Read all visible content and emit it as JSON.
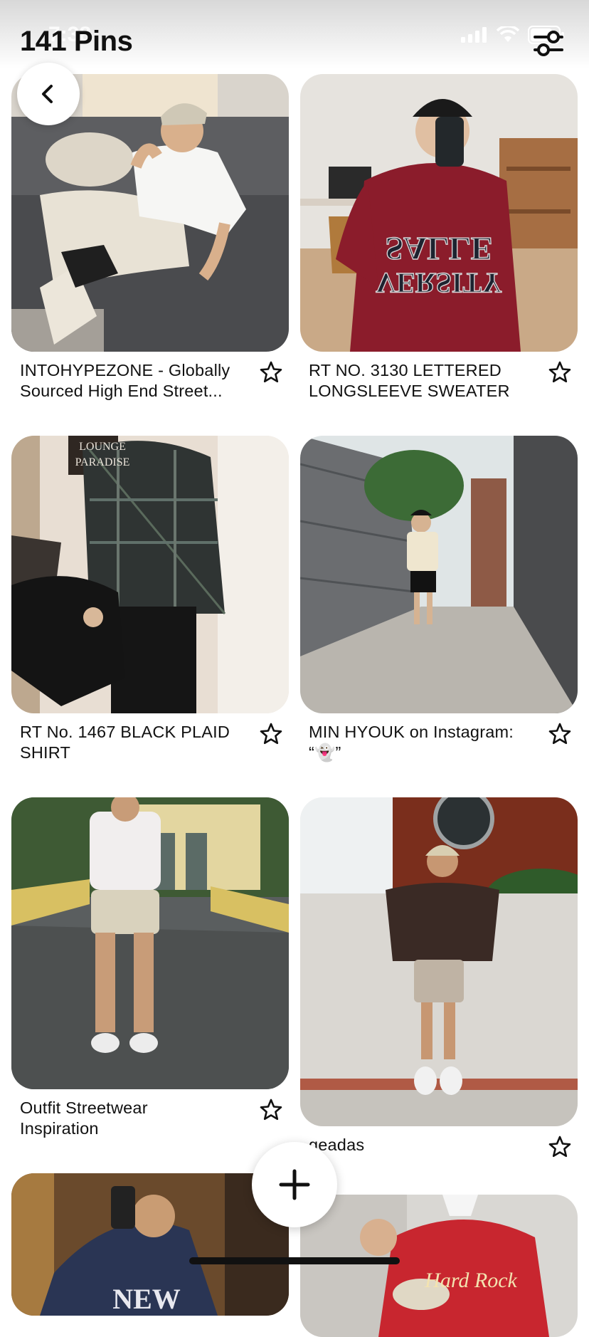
{
  "status_bar": {
    "time": "7:38"
  },
  "header": {
    "title": "141 Pins"
  },
  "icons": {
    "back": "chevron-left-icon",
    "filter": "sliders-icon",
    "add": "plus-icon",
    "save": "star-icon"
  },
  "pins": [
    {
      "title_lines": [
        "INTOHYPEZONE - Globally",
        "Sourced High End Street..."
      ]
    },
    {
      "title_lines": [
        "RT NO. 3130 LETTERED",
        "LONGSLEEVE SWEATER"
      ]
    },
    {
      "title_lines": [
        "RT No. 1467 BLACK PLAID",
        "SHIRT"
      ]
    },
    {
      "title_lines": [
        "MIN HYOUK on Instagram:",
        "“👻”"
      ]
    },
    {
      "title_lines": [
        "Outfit Streetwear",
        "Inspiration"
      ]
    },
    {
      "title_lines": [
        "geadas"
      ]
    }
  ],
  "image_text": {
    "sign_lines": [
      "LOUNGE",
      "PARADISE"
    ],
    "sweater_text": "SALLE VERSITY",
    "hardrock_text": "Hard Rock"
  }
}
